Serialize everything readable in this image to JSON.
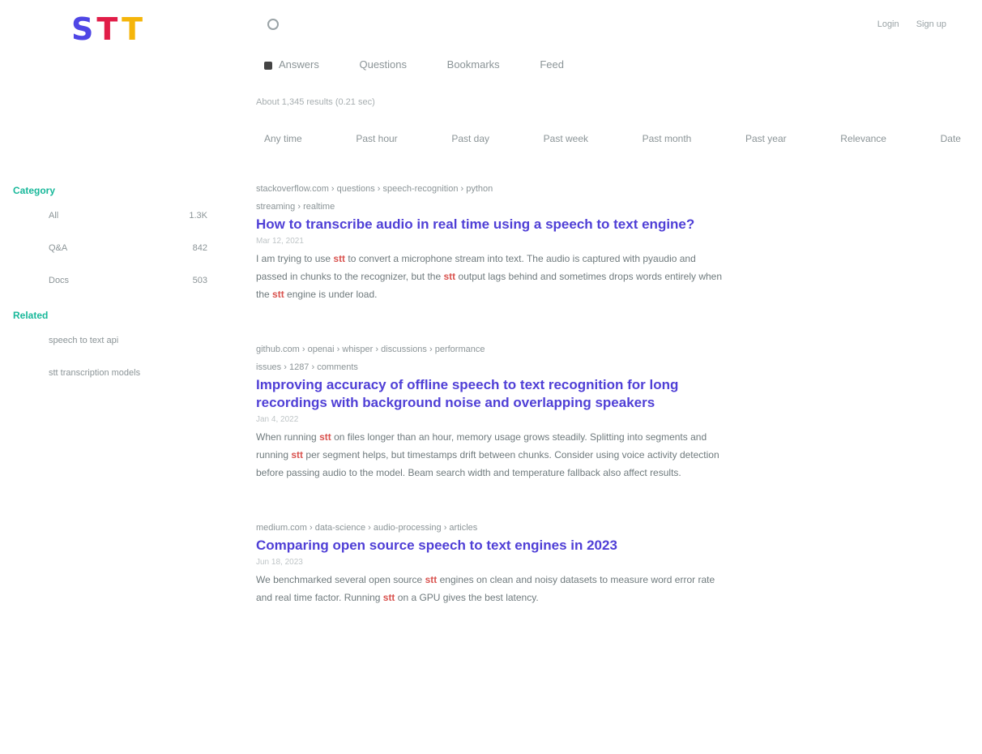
{
  "logo": {
    "s": "S",
    "t1": "T",
    "t2": "T"
  },
  "search": {
    "value": ""
  },
  "top_links": [
    "Login",
    "Sign up"
  ],
  "nav": [
    {
      "label": "Answers",
      "icon": "question-icon"
    },
    {
      "label": "Questions",
      "icon": "list-icon"
    },
    {
      "label": "Bookmarks",
      "icon": "bookmark-icon"
    },
    {
      "label": "Feed",
      "icon": "rss-icon"
    }
  ],
  "stats": "About 1,345 results (0.21 sec)",
  "filters": [
    "Any time",
    "Past hour",
    "Past day",
    "Past week",
    "Past month",
    "Past year",
    "Relevance",
    "Date"
  ],
  "sidebar": {
    "categories_heading": "Category",
    "categories": [
      {
        "label": "All",
        "count": "1.3K"
      },
      {
        "label": "Q&A",
        "count": "842"
      },
      {
        "label": "Docs",
        "count": "503"
      }
    ],
    "related_heading": "Related",
    "related": [
      "speech to text api",
      "stt transcription models"
    ]
  },
  "results": [
    {
      "path": "stackoverflow.com › questions › speech-recognition › python",
      "path2": "streaming › realtime",
      "title": "How to transcribe audio in real time using a speech to text engine?",
      "date": "Mar 12, 2021",
      "snippet_a": "I am trying to use",
      "highlight_a": "stt",
      "snippet_b": "to convert a microphone stream into text. The audio is captured with pyaudio and passed in chunks to the recognizer, but the",
      "highlight_b": "stt",
      "snippet_c": "output lags behind and sometimes drops words entirely when the",
      "highlight_c": "stt",
      "snippet_d": "engine is under load."
    },
    {
      "path": "github.com › openai › whisper › discussions › performance",
      "path2": "issues › 1287 › comments",
      "title": "Improving accuracy of offline speech to text recognition for long recordings with background noise and overlapping speakers",
      "date": "Jan 4, 2022",
      "snippet_a": "When running",
      "highlight_a": "stt",
      "snippet_b": "on files longer than an hour, memory usage grows steadily. Splitting into segments and running",
      "highlight_b": "stt",
      "snippet_c": "per segment helps, but timestamps drift between chunks. Consider using voice activity detection before passing audio to the model. Beam search width and temperature fallback also affect results."
    },
    {
      "path": "medium.com › data-science › audio-processing › articles",
      "title": "Comparing open source speech to text engines in 2023",
      "date": "Jun 18, 2023",
      "snippet_a": "We benchmarked several open source",
      "highlight_a": "stt",
      "snippet_b": "engines on clean and noisy datasets to measure word error rate and real time factor. Running",
      "highlight_b": "stt",
      "snippet_c": "on a GPU gives the best latency."
    }
  ]
}
